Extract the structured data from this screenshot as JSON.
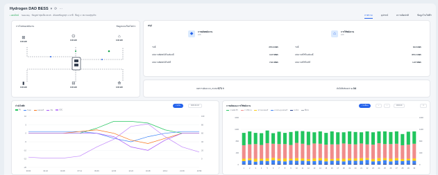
{
  "header": {
    "title": "Hydrogen DAD BESS",
    "status": "• ออนไลน์",
    "meta": "Saturday · ข้อมูลล่าสุดเมื่อ 09:45 · อัปเดตข้อมูลทุก 1 นาที · ที่อยู่ 1 / 99 ถนนสุขุมวิท",
    "tabs": [
      "ภาพรวม",
      "อุปกรณ์",
      "ความผิดปกติ",
      "ข้อมูลโรงไฟฟ้า"
    ]
  },
  "diagram": {
    "title": "การไหลของพลังงาน",
    "select": "ข้อมูลแบบเรียลไทม์ ▾",
    "nodes": {
      "pv": "0.00 kW",
      "inverter": "0.00 kW",
      "load": "0.00 kW",
      "battery": "0.00 kW",
      "meter": "0.00 kW",
      "grid": "0.00 kW"
    }
  },
  "summary": {
    "title": "สรุป",
    "generation": {
      "name": "การผลิตพลังงาน",
      "sub": "kWh",
      "rows": [
        {
          "label": "วันนี้",
          "value": "273.9 kWh"
        },
        {
          "label": "พลังงานที่ผลิตได้ในเดือนนี้",
          "value": "3.47 MWh"
        },
        {
          "label": "พลังงานที่ผลิตได้ในปีนี้",
          "value": "7.91 MWh"
        }
      ]
    },
    "consumption": {
      "name": "การใช้พลังงาน",
      "sub": "kWh",
      "rows": [
        {
          "label": "วันนี้",
          "value": "34.6 kWh"
        },
        {
          "label": "พลังงานที่ใช้ในเดือนนี้",
          "value": "874.4 kWh"
        },
        {
          "label": "พลังงานที่ใช้ในปีนี้",
          "value": "1.37 MWh"
        }
      ]
    },
    "strip": {
      "left_label": "ลดการปล่อย CO₂ สะสม",
      "left_value": "671 t",
      "right_label": "ต้นไม้ที่เทียบเท่า",
      "right_value": "34"
    }
  },
  "power_chart": {
    "title": "กำลังไฟฟ้า",
    "button": "รายวัน",
    "date": "2024-04-18",
    "legend": [
      "PV",
      "โหลด",
      "แบตเตอรี่",
      "กริด",
      "SOC"
    ],
    "colors": {
      "pv": "#22c55e",
      "load": "#3b82f6",
      "battery": "#f97316",
      "grid": "#a855f7",
      "soc": "#c084fc"
    }
  },
  "energy_chart": {
    "title": "การผลิตและการใช้พลังงาน",
    "button": "รายเดือน",
    "date": "2024-04",
    "legend": [
      "การผลิต PV",
      "การใช้งาน",
      "ชาร์จแบตเตอรี่",
      "คายประจุแบตเตอรี่",
      "ขายไฟ",
      "ซื้อไฟ"
    ],
    "colors": {
      "green": "#22c55e",
      "salmon": "#f08c8c",
      "yellow": "#facc15",
      "blue": "#3b82f6",
      "navy": "#1e3a8a"
    }
  },
  "chart_data": [
    {
      "type": "line",
      "x": [
        "00:00",
        "02:24",
        "04:48",
        "07:12",
        "09:36",
        "12:00",
        "14:24",
        "16:48",
        "19:12",
        "21:36",
        "23:59"
      ],
      "yleft_ticks": [
        10,
        5,
        0,
        -5,
        -10,
        -15,
        -20
      ],
      "yright_ticks": [
        100,
        80,
        60,
        40,
        20,
        0
      ],
      "series": [
        {
          "name": "PV",
          "values": [
            0,
            0,
            0,
            0,
            3,
            7,
            7,
            6,
            2,
            0,
            0
          ]
        },
        {
          "name": "โหลด",
          "values": [
            1,
            1,
            1,
            1,
            0,
            -3,
            -5,
            -2,
            0,
            1,
            1
          ]
        },
        {
          "name": "แบตเตอรี่",
          "values": [
            0,
            0,
            0,
            1,
            2,
            0,
            -4,
            -6,
            -3,
            0,
            0
          ]
        },
        {
          "name": "กริด",
          "values": [
            0,
            0,
            0,
            0,
            0,
            -2,
            -8,
            -10,
            -4,
            0,
            0
          ]
        },
        {
          "name": "SOC",
          "values": [
            20,
            18,
            18,
            22,
            40,
            55,
            80,
            85,
            60,
            40,
            30
          ]
        }
      ]
    },
    {
      "type": "bar",
      "categories": [
        "1",
        "2",
        "3",
        "4",
        "5",
        "6",
        "7",
        "8",
        "9",
        "10",
        "11",
        "12",
        "13",
        "14",
        "15",
        "16",
        "17",
        "18",
        "19",
        "20",
        "21",
        "22",
        "23",
        "24",
        "25",
        "26",
        "27",
        "28",
        "29",
        "30"
      ],
      "yleft_ticks": [
        1600,
        1200,
        800,
        400,
        0
      ],
      "yright_ticks": [
        1600,
        1200,
        800,
        400,
        0
      ],
      "series": [
        {
          "name": "การผลิต PV",
          "values": [
            420,
            440,
            380,
            400,
            430,
            360,
            420,
            380,
            440,
            400,
            430,
            450,
            380,
            420,
            400,
            440,
            410,
            380,
            430,
            420,
            380,
            440,
            420,
            400,
            430,
            410,
            420,
            380,
            440,
            420
          ]
        },
        {
          "name": "การใช้งาน",
          "values": [
            460,
            480,
            500,
            470,
            520,
            480,
            500,
            490,
            470,
            520,
            500,
            480,
            510,
            490,
            470,
            500,
            480,
            520,
            490,
            480,
            500,
            470,
            490,
            510,
            480,
            500,
            490,
            470,
            480,
            500
          ]
        },
        {
          "name": "ชาร์จแบตเตอรี่",
          "values": [
            80,
            60,
            100,
            70,
            90,
            80,
            70,
            100,
            60,
            90,
            80,
            70,
            90,
            80,
            100,
            60,
            80,
            90,
            70,
            80,
            90,
            60,
            80,
            100,
            70,
            90,
            80,
            70,
            60,
            80
          ]
        },
        {
          "name": "คายประจุแบตเตอรี่",
          "values": [
            100,
            120,
            80,
            110,
            90,
            130,
            100,
            90,
            120,
            100,
            110,
            90,
            100,
            120,
            80,
            110,
            100,
            90,
            120,
            100,
            110,
            130,
            90,
            100,
            120,
            90,
            110,
            100,
            120,
            100
          ]
        },
        {
          "name": "ขายไฟ",
          "values": [
            20,
            30,
            20,
            20,
            30,
            20,
            30,
            20,
            20,
            30,
            20,
            30,
            20,
            20,
            30,
            20,
            30,
            20,
            20,
            30,
            20,
            30,
            20,
            20,
            30,
            20,
            30,
            20,
            20,
            30
          ]
        }
      ]
    }
  ]
}
